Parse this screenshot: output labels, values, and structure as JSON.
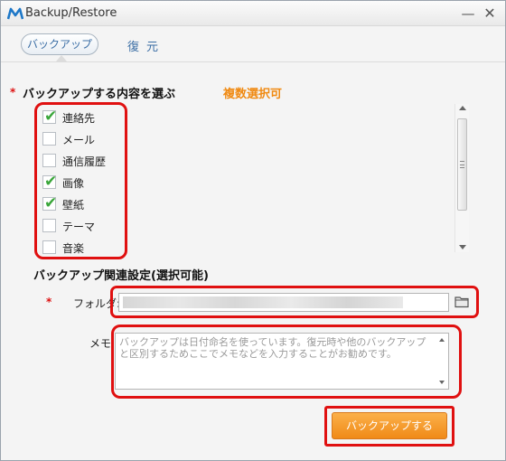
{
  "window": {
    "title": "Backup/Restore",
    "minimize_glyph": "—",
    "close_glyph": "✕"
  },
  "tabs": [
    {
      "label": "バックアップ",
      "active": true
    },
    {
      "label": "復元",
      "active": false
    }
  ],
  "content_section": {
    "required_mark": "*",
    "title": "バックアップする内容を選ぶ",
    "hint": "複数選択可",
    "items": [
      {
        "label": "連絡先",
        "checked": true
      },
      {
        "label": "メール",
        "checked": false
      },
      {
        "label": "通信履歴",
        "checked": false
      },
      {
        "label": "画像",
        "checked": true
      },
      {
        "label": "壁紙",
        "checked": true
      },
      {
        "label": "テーマ",
        "checked": false
      },
      {
        "label": "音楽",
        "checked": false
      }
    ],
    "check_glyph": "✔"
  },
  "settings_section": {
    "title": "バックアップ関連設定(選択可能)",
    "folder": {
      "required_mark": "*",
      "label": "フォルダ:",
      "value": "",
      "browse_icon": "folder-icon"
    },
    "memo": {
      "label": "メモ:",
      "placeholder": "バックアップは日付命名を使っています。復元時や他のバックアップと区別するためここでメモなどを入力することがお勧めです。"
    }
  },
  "actions": {
    "backup_label": "バックアップする"
  },
  "colors": {
    "accent_orange": "#f08a12",
    "annotation_red": "#e01010",
    "tab_blue": "#3b6ea5"
  }
}
